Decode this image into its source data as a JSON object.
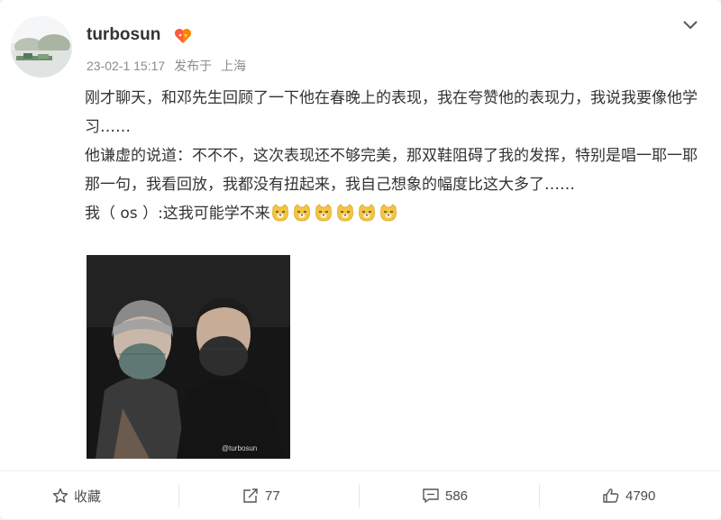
{
  "post": {
    "username": "turbosun",
    "timestamp": "23-02-1 15:17",
    "location_prefix": "发布于",
    "location": "上海",
    "paragraphs": [
      "刚才聊天，和邓先生回顾了一下他在春晚上的表现，我在夸赞他的表现力，我说我要像他学习……",
      "他谦虚的说道：不不不，这次表现还不够完美，那双鞋阻碍了我的发挥，特别是唱一耶一耶那一句，我看回放，我都没有扭起来，我自己想象的幅度比这大多了……"
    ],
    "last_line": "我（ os ）:这我可能学不来",
    "emoji_count": 6,
    "photo_watermark": "@turbosun"
  },
  "actions": {
    "favorite_label": "收藏",
    "repost_count": "77",
    "comment_count": "586",
    "like_count": "4790"
  },
  "icons": {
    "vip": "vip-heart-badge-icon",
    "menu": "chevron-down-icon",
    "favorite": "star-icon",
    "repost": "share-icon",
    "comment": "comment-icon",
    "like": "thumbs-up-icon",
    "emoji": "doge-cat-emoji-icon"
  },
  "colors": {
    "text": "#333333",
    "meta": "#8c8c8c",
    "vip_orange": "#ff8200"
  }
}
